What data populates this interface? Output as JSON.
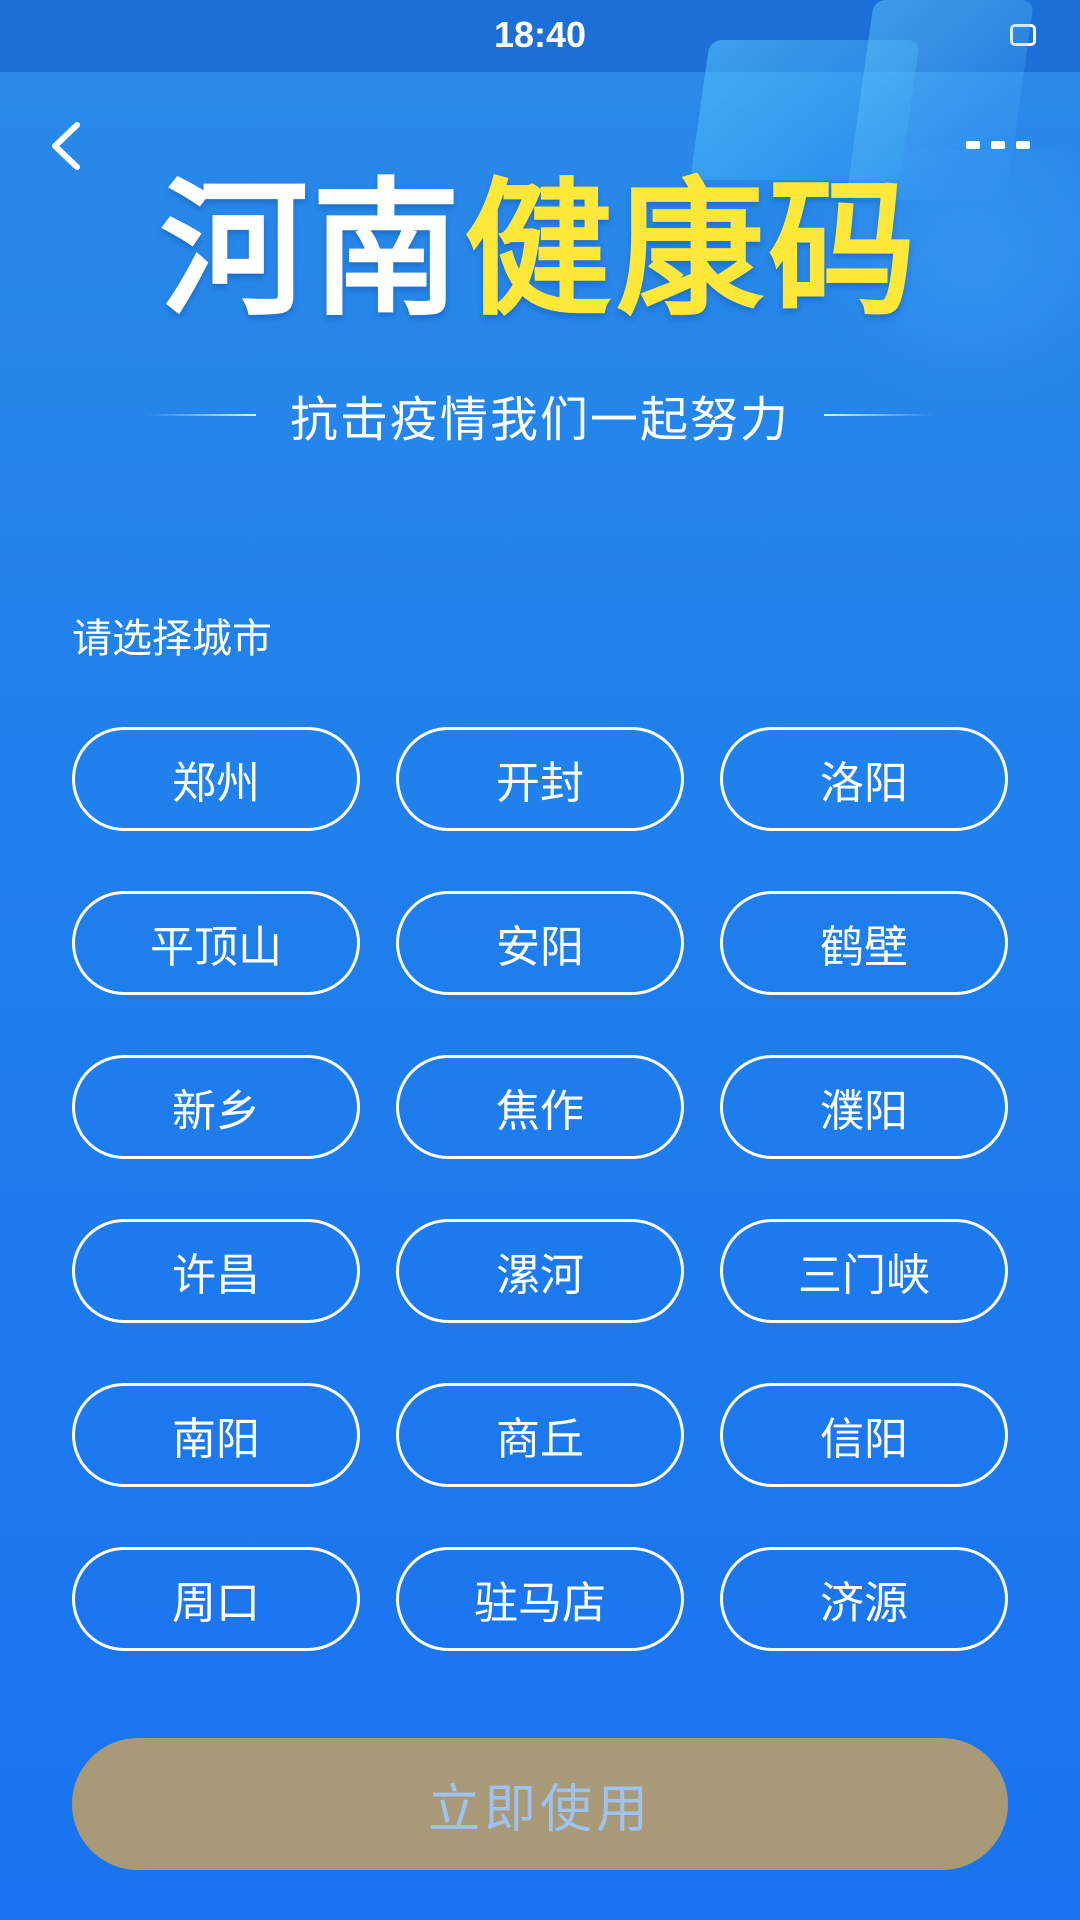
{
  "status_bar": {
    "time": "18:40"
  },
  "header": {
    "back_icon": "chevron-left-icon",
    "more_icon": "more-icon",
    "title_part1": "河南",
    "title_part2": "健康码",
    "subtitle": "抗击疫情我们一起努力",
    "colors": {
      "title_white": "#ffffff",
      "title_yellow": "#ffe83a"
    }
  },
  "city_select": {
    "label": "请选择城市",
    "cities": [
      "郑州",
      "开封",
      "洛阳",
      "平顶山",
      "安阳",
      "鹤壁",
      "新乡",
      "焦作",
      "濮阳",
      "许昌",
      "漯河",
      "三门峡",
      "南阳",
      "商丘",
      "信阳",
      "周口",
      "驻马店",
      "济源"
    ]
  },
  "action": {
    "use_label": "立即使用",
    "button_color": "#a89a78"
  },
  "colors": {
    "background": "#1f7fec",
    "accent": "#ffe83a"
  }
}
